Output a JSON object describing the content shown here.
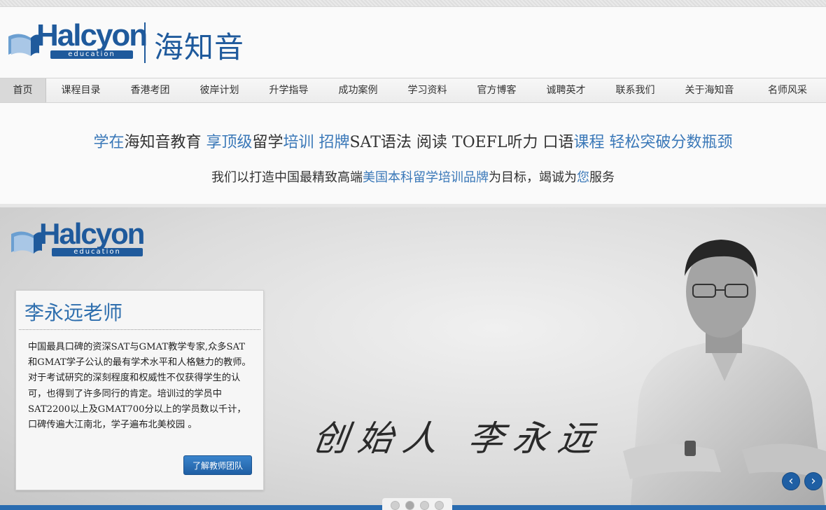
{
  "header": {
    "brand": "Halcyon",
    "brand_sub": "education",
    "brand_cn": "海知音"
  },
  "nav": {
    "items": [
      {
        "label": "首页",
        "active": true
      },
      {
        "label": "课程目录"
      },
      {
        "label": "香港考团"
      },
      {
        "label": "彼岸计划"
      },
      {
        "label": "升学指导"
      },
      {
        "label": "成功案例"
      },
      {
        "label": "学习资料"
      },
      {
        "label": "官方博客"
      },
      {
        "label": "诚聘英才"
      },
      {
        "label": "联系我们"
      },
      {
        "label": "关于海知音"
      },
      {
        "label": "名师风采"
      }
    ]
  },
  "slogan": {
    "line1": [
      {
        "text": "学在",
        "blue": true
      },
      {
        "text": "海知音教育 ",
        "blue": false
      },
      {
        "text": "享顶级",
        "blue": true
      },
      {
        "text": "留学",
        "blue": false
      },
      {
        "text": "培训 招牌",
        "blue": true
      },
      {
        "text": "SAT语法 阅读 TOEFL听力 口语",
        "blue": false
      },
      {
        "text": "课程 轻松突破分数瓶颈",
        "blue": true
      }
    ],
    "line2": [
      {
        "text": "我们以打造中国最精致高端",
        "blue": false
      },
      {
        "text": "美国本科留学培训品牌",
        "blue": true
      },
      {
        "text": "为目标，竭诚为",
        "blue": false
      },
      {
        "text": "您",
        "blue": true
      },
      {
        "text": "服务",
        "blue": false
      }
    ]
  },
  "hero": {
    "brand": "Halcyon",
    "brand_sub": "education",
    "card": {
      "title": "李永远老师",
      "body": "中国最具口碑的资深SAT与GMAT教学专家,众多SAT和GMAT学子公认的最有学术水平和人格魅力的教师。对于考试研究的深刻程度和权威性不仅获得学生的认可，也得到了许多同行的肯定。培训过的学员中SAT2200以上及GMAT700分以上的学员数以千计，口碑传遍大江南北，学子遍布北美校园 。",
      "button_label": "了解教师团队"
    },
    "signature": "创始人 李永远",
    "prev_label": "‹",
    "next_label": "›",
    "slides": 4,
    "active_slide": 1
  },
  "colors": {
    "brand_blue": "#1f5a9c",
    "accent_blue": "#3a78b8",
    "bar_blue": "#2a6cb0"
  }
}
